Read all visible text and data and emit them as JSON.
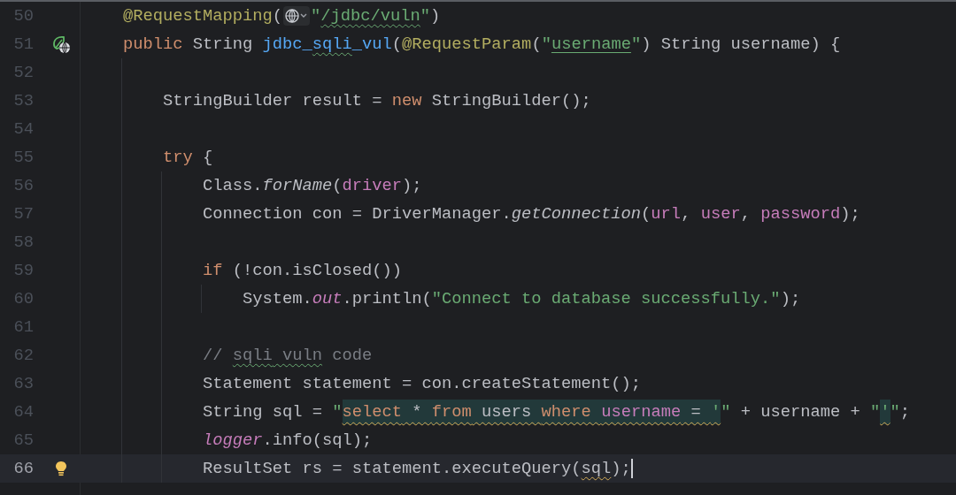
{
  "editor": {
    "lines": [
      {
        "number": "50",
        "current": false,
        "tokens": [
          {
            "text": "@RequestMapping",
            "kind": "annotation"
          },
          {
            "text": "(",
            "kind": "plain"
          },
          {
            "kind": "inlay"
          },
          {
            "text": "\"",
            "kind": "string"
          },
          {
            "text": "/jdbc/vuln",
            "kind": "string_link_typo"
          },
          {
            "text": "\"",
            "kind": "string"
          },
          {
            "text": ")",
            "kind": "plain"
          }
        ]
      },
      {
        "number": "51",
        "current": false,
        "gutter": {
          "kind": "endpoint"
        },
        "tokens": [
          {
            "text": "public",
            "kind": "keyword"
          },
          {
            "text": " String ",
            "kind": "plain"
          },
          {
            "text": "jdbc_",
            "kind": "declaration"
          },
          {
            "text": "sqli",
            "kind": "declaration_typo"
          },
          {
            "text": "_vul",
            "kind": "declaration"
          },
          {
            "text": "(",
            "kind": "plain"
          },
          {
            "text": "@RequestParam",
            "kind": "annotation"
          },
          {
            "text": "(",
            "kind": "plain"
          },
          {
            "text": "\"",
            "kind": "string"
          },
          {
            "text": "username",
            "kind": "string_link"
          },
          {
            "text": "\"",
            "kind": "string"
          },
          {
            "text": ") String username) {",
            "kind": "plain"
          }
        ],
        "children": [
          {
            "number": "52",
            "current": false
          },
          {
            "number": "53",
            "current": false,
            "tokens": [
              {
                "text": "StringBuilder result = ",
                "kind": "plain"
              },
              {
                "text": "new",
                "kind": "keyword"
              },
              {
                "text": " StringBuilder();",
                "kind": "plain"
              }
            ]
          },
          {
            "number": "54",
            "current": false
          },
          {
            "number": "55",
            "current": false,
            "tokens": [
              {
                "text": "try",
                "kind": "keyword"
              },
              {
                "text": " {",
                "kind": "plain"
              }
            ],
            "children": [
              {
                "number": "56",
                "current": false,
                "tokens": [
                  {
                    "text": "Class.",
                    "kind": "plain"
                  },
                  {
                    "text": "forName",
                    "kind": "static_method"
                  },
                  {
                    "text": "(",
                    "kind": "plain"
                  },
                  {
                    "text": "driver",
                    "kind": "field"
                  },
                  {
                    "text": ");",
                    "kind": "plain"
                  }
                ]
              },
              {
                "number": "57",
                "current": false,
                "tokens": [
                  {
                    "text": "Connection con = DriverManager.",
                    "kind": "plain"
                  },
                  {
                    "text": "getConnection",
                    "kind": "static_method"
                  },
                  {
                    "text": "(",
                    "kind": "plain"
                  },
                  {
                    "text": "url",
                    "kind": "field"
                  },
                  {
                    "text": ", ",
                    "kind": "plain"
                  },
                  {
                    "text": "user",
                    "kind": "field"
                  },
                  {
                    "text": ", ",
                    "kind": "plain"
                  },
                  {
                    "text": "password",
                    "kind": "field"
                  },
                  {
                    "text": ");",
                    "kind": "plain"
                  }
                ]
              },
              {
                "number": "58",
                "current": false
              },
              {
                "number": "59",
                "current": false,
                "tokens": [
                  {
                    "text": "if",
                    "kind": "keyword"
                  },
                  {
                    "text": " (!con.isClosed())",
                    "kind": "plain"
                  }
                ],
                "children": [
                  {
                    "number": "60",
                    "current": false,
                    "tokens": [
                      {
                        "text": "System.",
                        "kind": "plain"
                      },
                      {
                        "text": "out",
                        "kind": "static_field"
                      },
                      {
                        "text": ".println(",
                        "kind": "plain"
                      },
                      {
                        "text": "\"Connect to database successfully.\"",
                        "kind": "string"
                      },
                      {
                        "text": ");",
                        "kind": "plain"
                      }
                    ]
                  }
                ]
              },
              {
                "number": "61",
                "current": false
              },
              {
                "number": "62",
                "current": false,
                "tokens": [
                  {
                    "text": "// ",
                    "kind": "comment"
                  },
                  {
                    "text": "sqli",
                    "kind": "comment_typo"
                  },
                  {
                    "text": " vuln",
                    "kind": "comment_typo"
                  },
                  {
                    "text": " code",
                    "kind": "comment"
                  }
                ]
              },
              {
                "number": "63",
                "current": false,
                "tokens": [
                  {
                    "text": "Statement statement = con.createStatement();",
                    "kind": "plain"
                  }
                ]
              },
              {
                "number": "64",
                "current": false,
                "tokens": [
                  {
                    "text": "String sql = ",
                    "kind": "plain"
                  },
                  {
                    "text": "\"",
                    "kind": "string"
                  },
                  {
                    "text": "select",
                    "kind": "keyword_injected"
                  },
                  {
                    "text": " * ",
                    "kind": "plain_injected"
                  },
                  {
                    "text": "from",
                    "kind": "keyword_injected"
                  },
                  {
                    "text": " users ",
                    "kind": "plain_injected"
                  },
                  {
                    "text": "where ",
                    "kind": "keyword_injected"
                  },
                  {
                    "text": "username",
                    "kind": "field_injected"
                  },
                  {
                    "text": " = ",
                    "kind": "plain_injected"
                  },
                  {
                    "text": "'",
                    "kind": "string_injected"
                  },
                  {
                    "text": "\"",
                    "kind": "string"
                  },
                  {
                    "text": " + username + ",
                    "kind": "plain"
                  },
                  {
                    "text": "\"",
                    "kind": "string"
                  },
                  {
                    "text": "'",
                    "kind": "string_injected"
                  },
                  {
                    "text": "\"",
                    "kind": "string"
                  },
                  {
                    "text": ";",
                    "kind": "plain"
                  }
                ]
              },
              {
                "number": "65",
                "current": false,
                "tokens": [
                  {
                    "text": "logger",
                    "kind": "static_field"
                  },
                  {
                    "text": ".info(sql);",
                    "kind": "plain"
                  }
                ]
              },
              {
                "number": "66",
                "current": true,
                "gutter": {
                  "kind": "bulb"
                },
                "tokens": [
                  {
                    "text": "ResultSet rs = statement.executeQuery(",
                    "kind": "plain"
                  },
                  {
                    "text": "sql",
                    "kind": "plain_warning"
                  },
                  {
                    "text": ");",
                    "kind": "plain"
                  }
                ]
              }
            ]
          }
        ]
      }
    ]
  }
}
